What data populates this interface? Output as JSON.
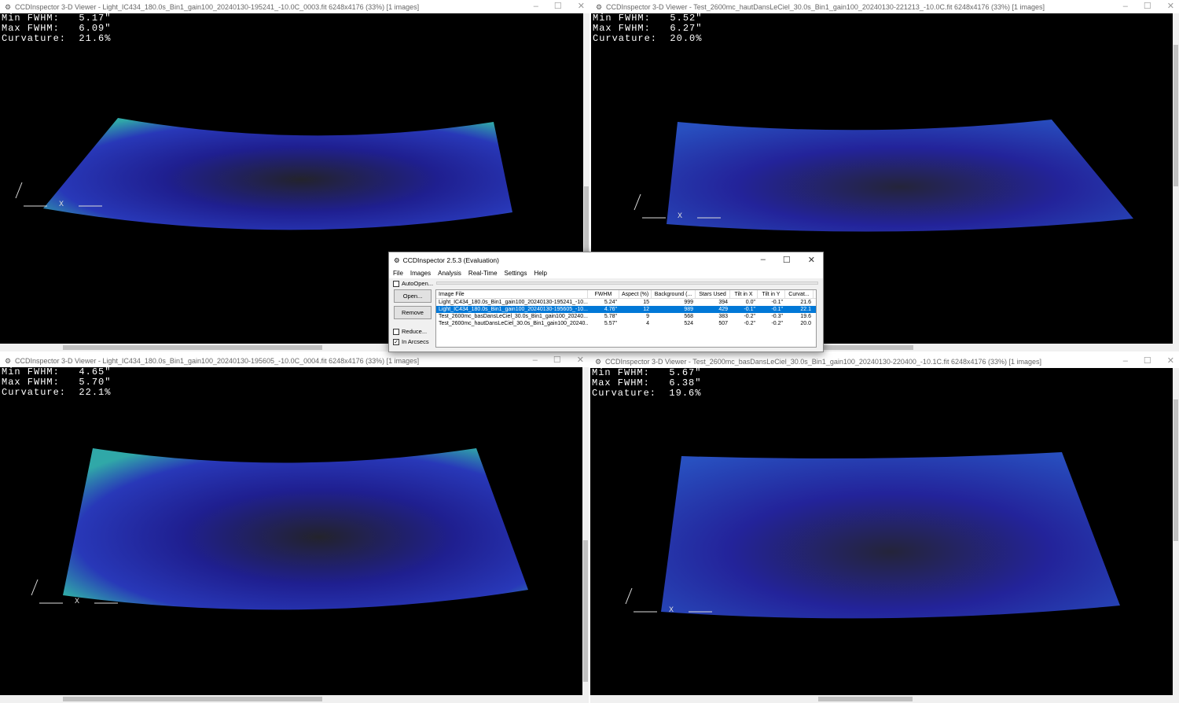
{
  "viewers": [
    {
      "title": "CCDInspector 3-D Viewer - Light_IC434_180.0s_Bin1_gain100_20240130-195241_-10.0C_0003.fit 6248x4176 (33%)  [1 images]",
      "min_fwhm": "5.17\"",
      "max_fwhm": "6.09\"",
      "curvature": "21.6%"
    },
    {
      "title": "CCDInspector 3-D Viewer - Test_2600mc_hautDansLeCiel_30.0s_Bin1_gain100_20240130-221213_-10.0C.fit 6248x4176 (33%)  [1 images]",
      "min_fwhm": "5.52\"",
      "max_fwhm": "6.27\"",
      "curvature": "20.0%"
    },
    {
      "title": "CCDInspector 3-D Viewer - Light_IC434_180.0s_Bin1_gain100_20240130-195605_-10.0C_0004.fit 6248x4176 (33%)  [1 images]",
      "min_fwhm": "4.65\"",
      "max_fwhm": "5.70\"",
      "curvature": "22.1%"
    },
    {
      "title": "CCDInspector 3-D Viewer - Test_2600mc_basDansLeCiel_30.0s_Bin1_gain100_20240130-220400_-10.1C.fit 6248x4176 (33%)  [1 images]",
      "min_fwhm": "5.67\"",
      "max_fwhm": "6.38\"",
      "curvature": "19.6%"
    }
  ],
  "labels": {
    "min_fwhm": "Min FWHM:",
    "max_fwhm": "Max FWHM:",
    "curvature": "Curvature:",
    "axis_x": "X",
    "minimize": "–",
    "maximize": "☐",
    "close": "✕"
  },
  "dialog": {
    "title": "CCDInspector 2.5.3 (Evaluation)",
    "menu": [
      "File",
      "Images",
      "Analysis",
      "Real-Time",
      "Settings",
      "Help"
    ],
    "autoopen": "AutoOpen...",
    "open": "Open...",
    "remove": "Remove",
    "reduce": "Reduce...",
    "in_arcsecs": "In Arcsecs",
    "in_arcsecs_checked": true,
    "columns": [
      "Image File",
      "FWHM",
      "Aspect (%)",
      "Background (...",
      "Stars Used",
      "Tilt in X",
      "Tilt in Y",
      "Curvat..."
    ],
    "rows": [
      [
        "Light_IC434_180.0s_Bin1_gain100_20240130-195241_-10...",
        "5.24\"",
        "15",
        "999",
        "394",
        "0.0\"",
        "-0.1\"",
        "21.6"
      ],
      [
        "Light_IC434_180.0s_Bin1_gain100_20240130-195605_-10...",
        "4.76\"",
        "12",
        "989",
        "429",
        "-0.1\"",
        "-0.1\"",
        "22.1"
      ],
      [
        "Test_2600mc_basDansLeCiel_30.0s_Bin1_gain100_20240...",
        "5.78\"",
        "9",
        "568",
        "383",
        "-0.2\"",
        "-0.3\"",
        "19.6"
      ],
      [
        "Test_2600mc_hautDansLeCiel_30.0s_Bin1_gain100_20240...",
        "5.57\"",
        "4",
        "524",
        "507",
        "-0.2\"",
        "-0.2\"",
        "20.0"
      ]
    ],
    "selected_row": 1
  }
}
